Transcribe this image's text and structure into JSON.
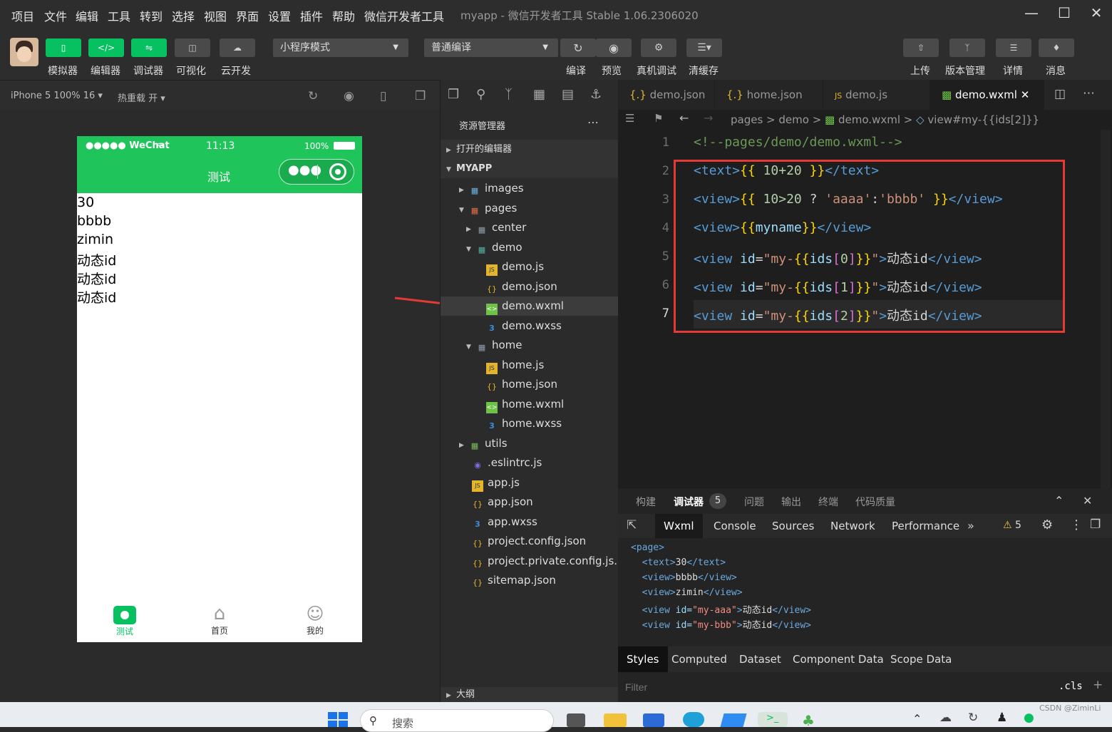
{
  "menubar": {
    "items": [
      "项目",
      "文件",
      "编辑",
      "工具",
      "转到",
      "选择",
      "视图",
      "界面",
      "设置",
      "插件",
      "帮助",
      "微信开发者工具"
    ],
    "window_title": "myapp - 微信开发者工具 Stable 1.06.2306020"
  },
  "toolbar": {
    "left_buttons": [
      "模拟器",
      "编辑器",
      "调试器",
      "可视化",
      "云开发"
    ],
    "mode_select": "小程序模式",
    "compile_select": "普通编译",
    "mid_buttons": [
      "编译",
      "预览",
      "真机调试",
      "清缓存"
    ],
    "right_buttons": [
      "上传",
      "版本管理",
      "详情",
      "消息"
    ]
  },
  "simulator_bar": {
    "device": "iPhone 5 100% 16",
    "hot_reload": "热重载 开"
  },
  "phone": {
    "carrier": "●●●●● WeChat",
    "time": "11:13",
    "battery": "100%",
    "nav_title": "测试",
    "content_lines": [
      "30",
      "bbbb",
      "zimin",
      "动态id",
      "动态id",
      "动态id"
    ],
    "tabs": [
      "测试",
      "首页",
      "我的"
    ],
    "accent_color": "#07c160"
  },
  "explorer": {
    "title": "资源管理器",
    "sections": [
      "打开的编辑器",
      "MYAPP",
      "大纲"
    ],
    "items": [
      {
        "label": "images",
        "type": "folder"
      },
      {
        "label": "pages",
        "type": "folder"
      },
      {
        "label": "center",
        "type": "folder"
      },
      {
        "label": "demo",
        "type": "folder"
      },
      {
        "label": "demo.js",
        "type": "js"
      },
      {
        "label": "demo.json",
        "type": "json"
      },
      {
        "label": "demo.wxml",
        "type": "wxml"
      },
      {
        "label": "demo.wxss",
        "type": "wxss"
      },
      {
        "label": "home",
        "type": "folder"
      },
      {
        "label": "home.js",
        "type": "js"
      },
      {
        "label": "home.json",
        "type": "json"
      },
      {
        "label": "home.wxml",
        "type": "wxml"
      },
      {
        "label": "home.wxss",
        "type": "wxss"
      },
      {
        "label": "utils",
        "type": "folder"
      },
      {
        "label": ".eslintrc.js",
        "type": "eslint"
      },
      {
        "label": "app.js",
        "type": "js"
      },
      {
        "label": "app.json",
        "type": "json"
      },
      {
        "label": "app.wxss",
        "type": "wxss"
      },
      {
        "label": "project.config.json",
        "type": "json"
      },
      {
        "label": "project.private.config.js...",
        "type": "json"
      },
      {
        "label": "sitemap.json",
        "type": "json"
      }
    ]
  },
  "editor_tabs": [
    "demo.json",
    "home.json",
    "demo.js",
    "demo.wxml"
  ],
  "breadcrumb": {
    "parts": [
      "pages",
      "demo",
      "demo.wxml",
      "view#my-{{ids[2]}}"
    ]
  },
  "code_lines": [
    "<!--pages/demo/demo.wxml-->",
    "<text>{{ 10+20 }}</text>",
    "<view>{{ 10>20 ? 'aaaa':'bbbb' }}</view>",
    "<view>{{myname}}</view>",
    "<view id=\"my-{{ids[0]}}\">动态id</view>",
    "<view id=\"my-{{ids[1]}}\">动态id</view>",
    "<view id=\"my-{{ids[2]}}\">动态id</view>"
  ],
  "line_numbers": [
    "1",
    "2",
    "3",
    "4",
    "5",
    "6",
    "7"
  ],
  "devtools": {
    "panel_tabs": [
      "构建",
      "调试器",
      "问题",
      "输出",
      "终端",
      "代码质量"
    ],
    "debugger_badge": "5",
    "tabs": [
      "Wxml",
      "Console",
      "Sources",
      "Network",
      "Performance"
    ],
    "warning_count": "5",
    "xml_lines": [
      "<page>",
      "  <text>30</text>",
      "  <view>bbbb</view>",
      "  <view>zimin</view>",
      "  <view id=\"my-aaa\">动态id</view>",
      "  <view id=\"my-bbb\">动态id</view>"
    ],
    "style_tabs": [
      "Styles",
      "Computed",
      "Dataset",
      "Component Data",
      "Scope Data"
    ],
    "filter_placeholder": "Filter",
    "cls_label": ".cls"
  },
  "taskbar": {
    "search_placeholder": "搜索",
    "watermark": "CSDN @ZiminLi"
  }
}
